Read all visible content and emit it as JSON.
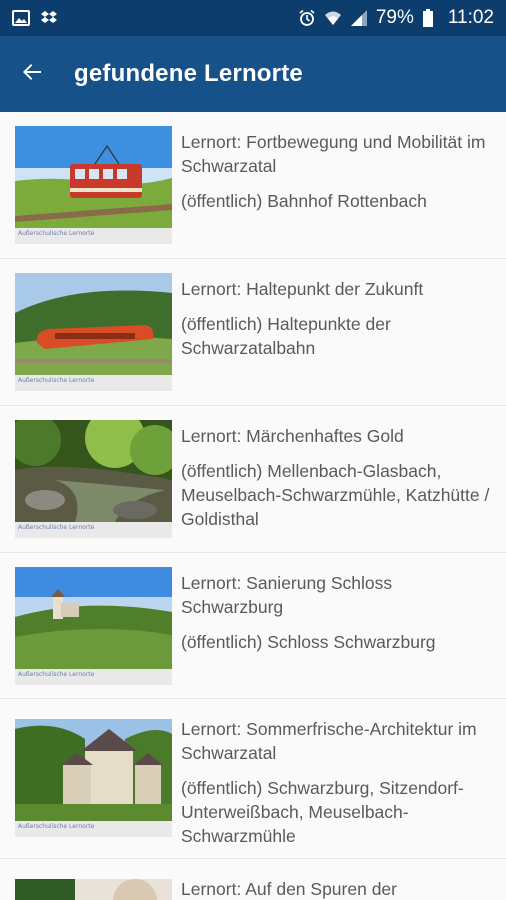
{
  "status_bar": {
    "battery": "79%",
    "time": "11:02",
    "icons": [
      "image-icon",
      "dropbox-icon",
      "alarm-icon",
      "wifi-icon",
      "signal-icon",
      "battery-icon"
    ]
  },
  "app_bar": {
    "title": "gefundene Lernorte",
    "back_icon": "arrow-left-icon",
    "color": "#17518a"
  },
  "items": [
    {
      "title": "Lernort: Fortbewegung und Mobilität im Schwarzatal",
      "location": "(öffentlich) Bahnhof Rottenbach",
      "image_caption": "Außerschulische Lernorte"
    },
    {
      "title": "Lernort: Haltepunkt der Zukunft",
      "location": "(öffentlich) Haltepunkte der Schwarzatalbahn",
      "image_caption": "Außerschulische Lernorte"
    },
    {
      "title": "Lernort: Märchenhaftes Gold",
      "location": "(öffentlich) Mellenbach-Glasbach, Meuselbach-Schwarzmühle, Katzhütte / Goldisthal",
      "image_caption": "Außerschulische Lernorte"
    },
    {
      "title": "Lernort: Sanierung Schloss Schwarzburg",
      "location": "(öffentlich) Schloss Schwarzburg",
      "image_caption": "Außerschulische Lernorte"
    },
    {
      "title": "Lernort: Sommerfrische-Architektur im Schwarzatal",
      "location": "(öffentlich) Schwarzburg, Sitzendorf-Unterweißbach, Meuselbach-Schwarzmühle",
      "image_caption": "Außerschulische Lernorte"
    },
    {
      "title": "Lernort: Auf den Spuren der",
      "location": "",
      "image_caption": ""
    }
  ]
}
